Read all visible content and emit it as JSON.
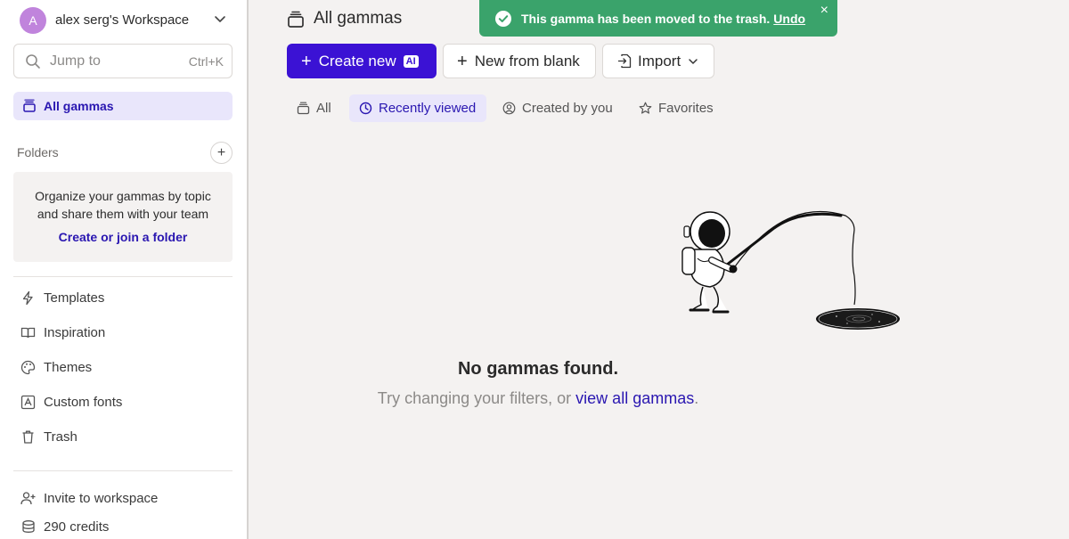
{
  "workspace": {
    "avatar_letter": "A",
    "name": "alex serg's Workspace"
  },
  "search": {
    "placeholder": "Jump to",
    "shortcut": "Ctrl+K"
  },
  "sidebar": {
    "all_gammas": "All gammas",
    "folders_heading": "Folders",
    "folder_prompt": {
      "line1": "Organize your gammas by topic",
      "line2": "and share them with your team",
      "link": "Create or join a folder"
    },
    "items": [
      {
        "label": "Templates",
        "icon": "lightning-icon"
      },
      {
        "label": "Inspiration",
        "icon": "book-icon"
      },
      {
        "label": "Themes",
        "icon": "palette-icon"
      },
      {
        "label": "Custom fonts",
        "icon": "font-icon"
      },
      {
        "label": "Trash",
        "icon": "trash-icon"
      }
    ],
    "footer": [
      {
        "label": "Invite to workspace",
        "icon": "add-user-icon"
      },
      {
        "label": "290 credits",
        "icon": "coins-icon"
      }
    ]
  },
  "main": {
    "title": "All gammas",
    "buttons": {
      "create_new": "Create new",
      "ai_badge": "AI",
      "new_from_blank": "New from blank",
      "import": "Import"
    },
    "filters": [
      {
        "label": "All",
        "active": false
      },
      {
        "label": "Recently viewed",
        "active": true
      },
      {
        "label": "Created by you",
        "active": false
      },
      {
        "label": "Favorites",
        "active": false
      }
    ],
    "empty": {
      "title": "No gammas found.",
      "subtitle_prefix": "Try changing your filters, or ",
      "subtitle_link": "view all gammas",
      "subtitle_suffix": "."
    }
  },
  "toast": {
    "message": "This gamma has been moved to the trash.",
    "undo": "Undo",
    "close": "×"
  },
  "colors": {
    "accent": "#3b12d4",
    "accent_text": "#2a17b1",
    "active_bg": "#e9e6fb",
    "toast_bg": "#3aa36b",
    "page_bg": "#f4f2f1"
  }
}
